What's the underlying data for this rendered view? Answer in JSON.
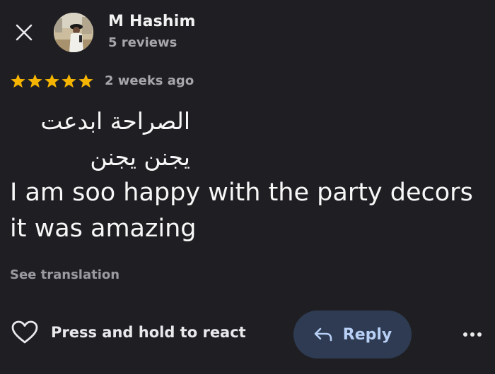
{
  "header": {
    "close_icon": "close-icon",
    "reviewer_name": "M Hashim",
    "review_count": "5 reviews"
  },
  "rating": {
    "stars": 5,
    "max_stars": 5,
    "star_color": "#f4b400",
    "time_ago": "2 weeks ago"
  },
  "review": {
    "arabic_line_1": "الصراحة ابدعت",
    "arabic_line_2": "يجنن يجنن",
    "english_text": "I am soo happy with the party decors it was amazing",
    "see_translation": "See translation"
  },
  "actions": {
    "react_label": "Press and hold to react",
    "reply_label": "Reply",
    "reply_bg_color": "#2e3b52",
    "reply_text_color": "#b8d0f5",
    "more_icon": "more-options-icon"
  },
  "colors": {
    "background": "#1f1f23",
    "secondary_text": "#a6a6ab"
  }
}
